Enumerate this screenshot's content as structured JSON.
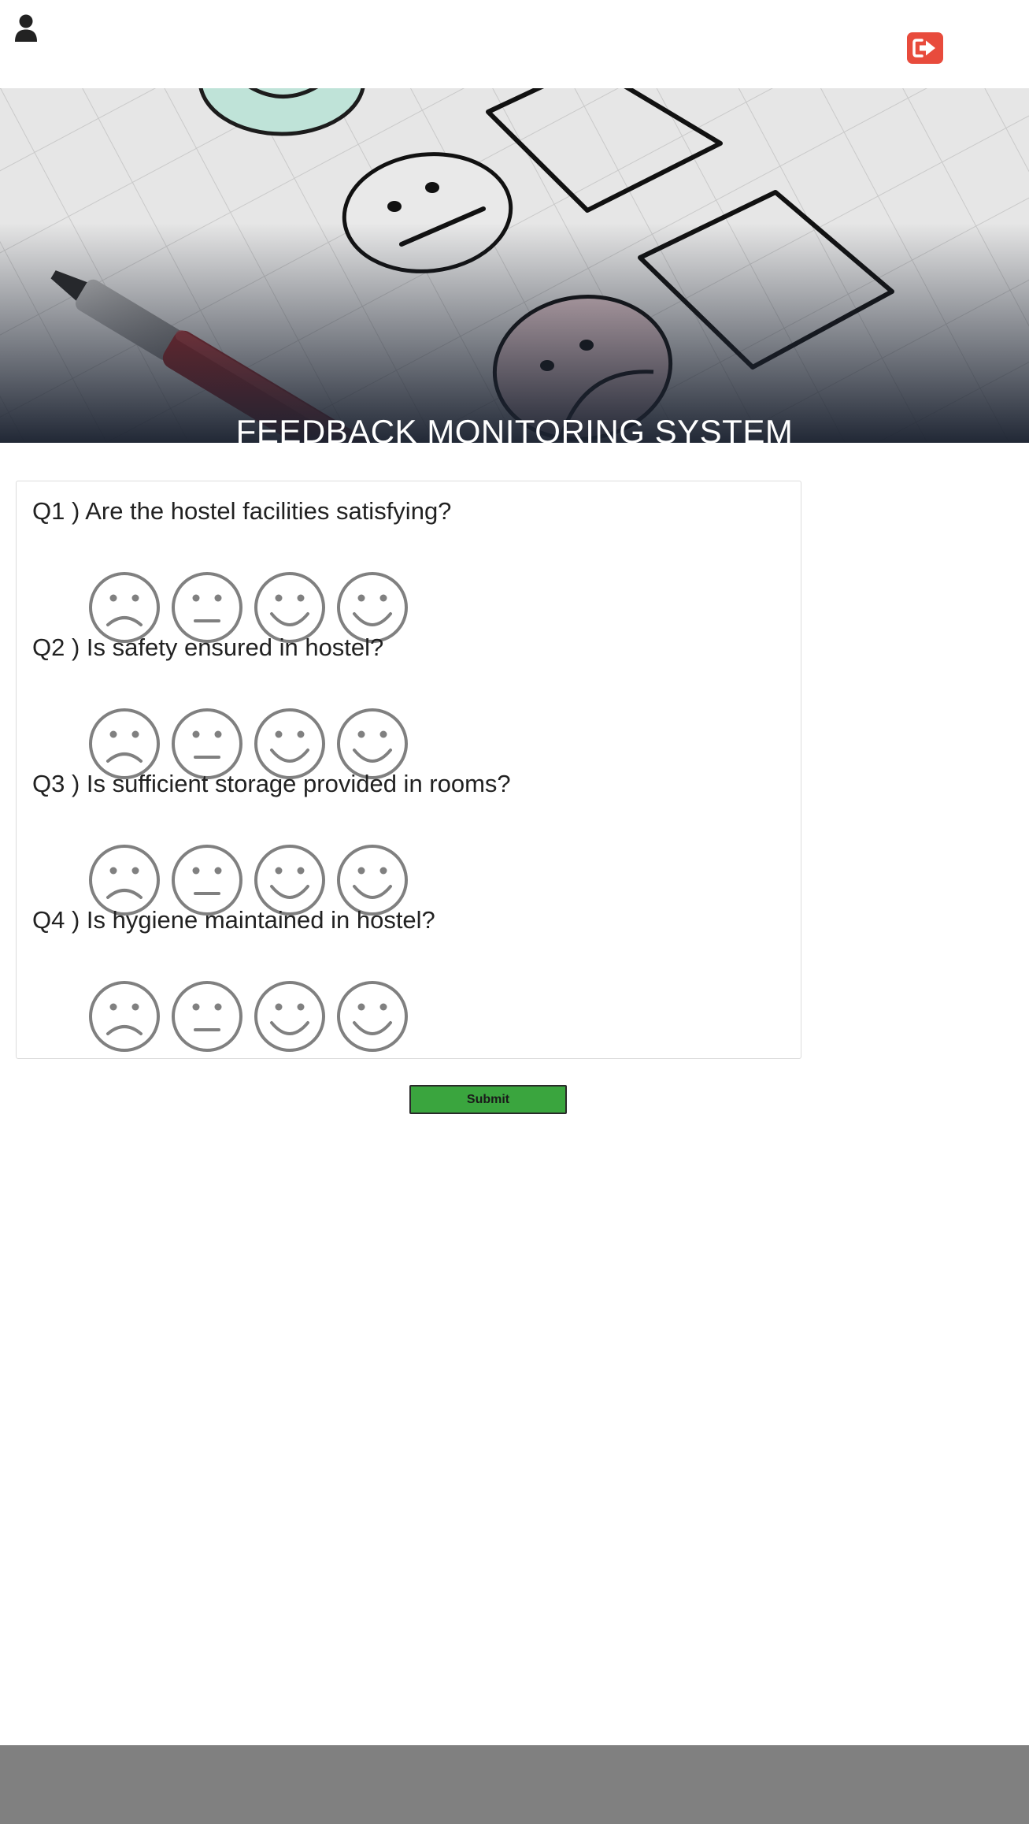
{
  "header": {
    "user_icon": "user-icon",
    "logout_icon": "logout-icon",
    "logout_color": "#e84b3c"
  },
  "hero": {
    "title": "FEEDBACK MONITORING SYSTEM"
  },
  "questions": [
    {
      "label": "Q1 ) Are the hostel facilities satisfying?"
    },
    {
      "label": "Q2 ) Is safety ensured in hostel?"
    },
    {
      "label": "Q3 ) Is sufficient storage provided in rooms?"
    },
    {
      "label": "Q4 ) Is hygiene maintained in hostel?"
    }
  ],
  "rating_options": [
    "sad-face-icon",
    "neutral-face-icon",
    "smile-face-icon",
    "happy-face-icon"
  ],
  "submit": {
    "label": "Submit",
    "color": "#3aa53e"
  },
  "footer": {
    "color": "#808080"
  }
}
